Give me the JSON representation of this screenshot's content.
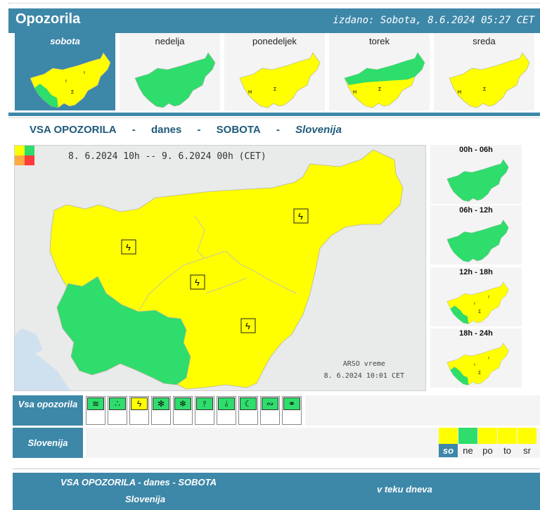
{
  "header": {
    "title": "Opozorila",
    "issued": "izdano: Sobota, 8.6.2024 05:27 CET"
  },
  "days": [
    {
      "label": "sobota",
      "active": true
    },
    {
      "label": "nedelja",
      "active": false
    },
    {
      "label": "ponedeljek",
      "active": false
    },
    {
      "label": "torek",
      "active": false
    },
    {
      "label": "sreda",
      "active": false
    }
  ],
  "section": {
    "part1": "VSA OPOZORILA",
    "sep": "-",
    "part2": "danes",
    "part3": "SOBOTA",
    "part4": "Slovenija"
  },
  "map": {
    "dates": "8. 6.2024 10h -- 9. 6.2024 00h   (CET)",
    "credit_line1": "ARSO vreme",
    "credit_line2": "8. 6.2024  10:01 CET"
  },
  "intervals": [
    "00h - 06h",
    "06h - 12h",
    "12h - 18h",
    "18h - 24h"
  ],
  "rows": {
    "all": "Vsa opozorila",
    "region": "Slovenija"
  },
  "warning_icons": [
    {
      "name": "wind-icon",
      "glyph": "≋",
      "level": "green"
    },
    {
      "name": "rain-icon",
      "glyph": "∴",
      "level": "green"
    },
    {
      "name": "thunderstorm-icon",
      "glyph": "ϟ",
      "level": "yellow"
    },
    {
      "name": "snow-icon",
      "glyph": "✻",
      "level": "green"
    },
    {
      "name": "snow-rain-icon",
      "glyph": "❄",
      "level": "green"
    },
    {
      "name": "high-temperature-icon",
      "glyph": "🌡",
      "level": "green"
    },
    {
      "name": "low-temperature-icon",
      "glyph": "🌡",
      "level": "green"
    },
    {
      "name": "fog-icon",
      "glyph": "☾",
      "level": "green"
    },
    {
      "name": "coastal-icon",
      "glyph": "∾",
      "level": "green"
    },
    {
      "name": "avalanche-icon",
      "glyph": "⚭",
      "level": "green"
    }
  ],
  "legend": [
    {
      "label": "so",
      "color": "#ffff00",
      "active": true
    },
    {
      "label": "ne",
      "color": "#2edd6b",
      "active": false
    },
    {
      "label": "po",
      "color": "#ffff00",
      "active": false
    },
    {
      "label": "to",
      "color": "#ffff00",
      "active": false
    },
    {
      "label": "sr",
      "color": "#ffff00",
      "active": false
    }
  ],
  "footer": {
    "line1": "VSA OPOZORILA - danes - SOBOTA",
    "line2": "Slovenija",
    "right": "v teku dneva"
  },
  "colors": {
    "header": "#3d87a8",
    "green": "#2edd6b",
    "yellow": "#ffff00",
    "orange": "#ffa940",
    "red": "#ff3b3b"
  }
}
